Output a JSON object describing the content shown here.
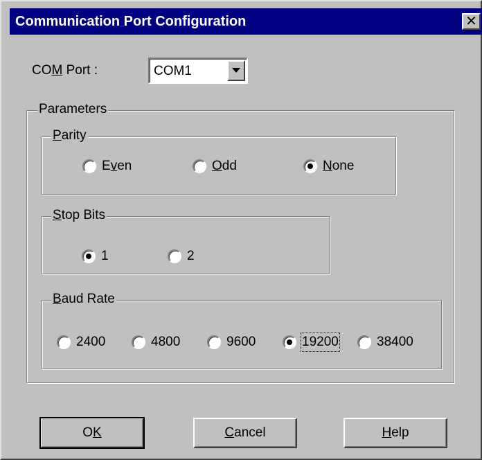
{
  "window": {
    "title": "Communication Port Configuration",
    "close_glyph": "✕"
  },
  "com_port": {
    "label_pre": "CO",
    "label_u": "M",
    "label_post": " Port  :",
    "value": "COM1"
  },
  "parameters": {
    "title": "Parameters",
    "parity": {
      "title_u": "P",
      "title_rest": "arity",
      "options": [
        {
          "pre": "E",
          "u": "v",
          "post": "en",
          "checked": false
        },
        {
          "pre": "",
          "u": "O",
          "post": "dd",
          "checked": false
        },
        {
          "pre": "",
          "u": "N",
          "post": "one",
          "checked": true
        }
      ]
    },
    "stop_bits": {
      "title_u": "S",
      "title_rest": "top Bits",
      "options": [
        {
          "label": "1",
          "checked": true
        },
        {
          "label": "2",
          "checked": false
        }
      ]
    },
    "baud_rate": {
      "title_u": "B",
      "title_rest": "aud Rate",
      "options": [
        {
          "label": "2400",
          "checked": false
        },
        {
          "label": "4800",
          "checked": false
        },
        {
          "label": "9600",
          "checked": false
        },
        {
          "label": "19200",
          "checked": true
        },
        {
          "label": "38400",
          "checked": false
        }
      ]
    }
  },
  "buttons": {
    "ok": {
      "pre": "O",
      "u": "K",
      "post": ""
    },
    "cancel": {
      "pre": "",
      "u": "C",
      "post": "ancel"
    },
    "help": {
      "pre": "",
      "u": "H",
      "post": "elp"
    }
  }
}
